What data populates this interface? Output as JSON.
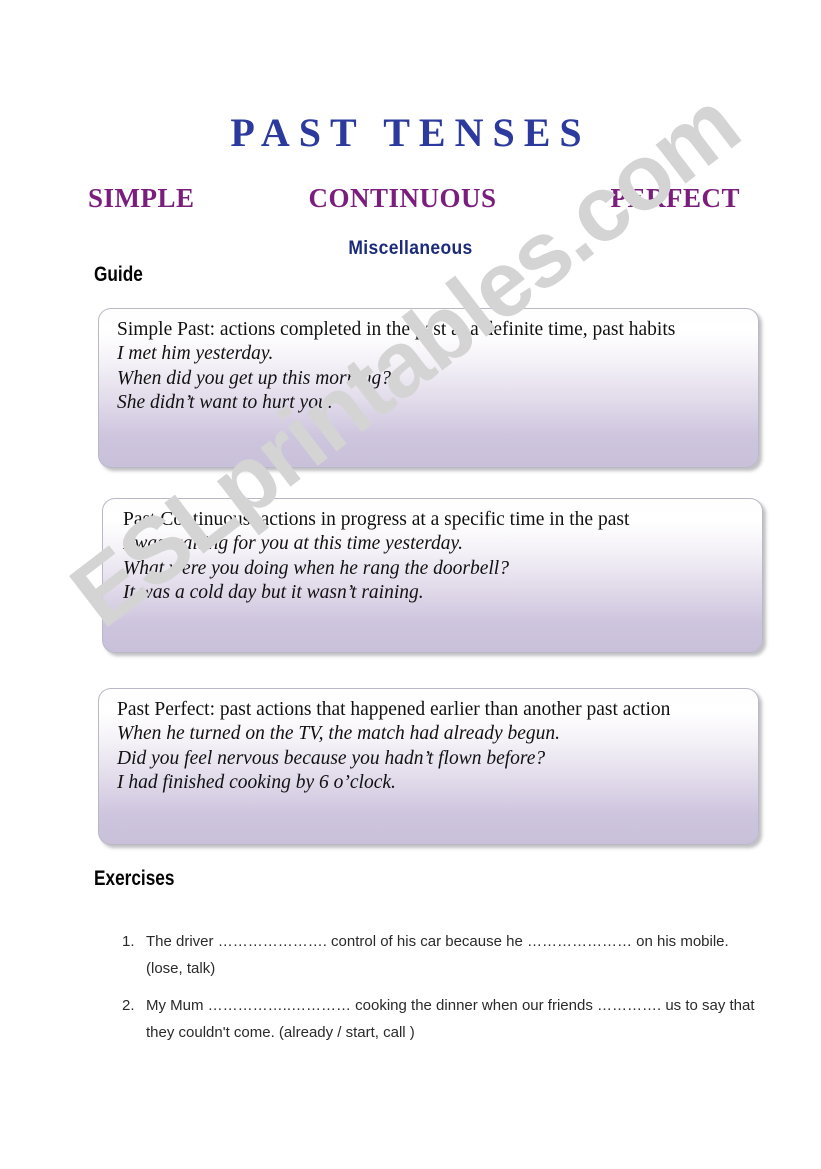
{
  "page": {
    "title": "PAST TENSES",
    "subtitles": [
      "SIMPLE",
      "CONTINUOUS",
      "PERFECT"
    ],
    "misc_label": "Miscellaneous",
    "guide_heading": "Guide",
    "exercises_heading": "Exercises",
    "watermark": "ESLprintables.com"
  },
  "colors": {
    "title_blue": "#2b3a9c",
    "subtitle_purple": "#7b1d7d",
    "misc_navy": "#1c2a7a",
    "box_gradient_top": "#ffffff",
    "box_gradient_bottom": "#c9c0d9",
    "box_border": "#b9b9c6",
    "watermark_gray": "#d4d4d4",
    "body_text": "#111111"
  },
  "guide": {
    "boxes": [
      {
        "id": "simple",
        "definition": "Simple Past: actions completed in the past at a definite time, past habits",
        "examples": [
          "I met him yesterday.",
          "When did you get up this morning?",
          "She didn’t want to hurt you."
        ]
      },
      {
        "id": "continuous",
        "definition": "Past Continuous: actions in progress at a specific time in the past",
        "examples": [
          "I was waiting for you at this time yesterday.",
          "What were you doing when he rang the doorbell?",
          "It was a cold day but it wasn’t raining."
        ]
      },
      {
        "id": "perfect",
        "definition": "Past Perfect: past actions that happened earlier than another past action",
        "examples": [
          "When he turned on the TV, the match had already begun.",
          "Did you feel nervous because you hadn’t flown before?",
          "I had finished cooking by 6 o’clock."
        ]
      }
    ]
  },
  "exercises": {
    "items": [
      {
        "number": "1.",
        "text": "The driver …………………. control of his car because he …………………  on his mobile. (lose, talk)"
      },
      {
        "number": "2.",
        "text": "My Mum ……………..………… cooking the dinner when our friends …………. us to say that they couldn't come.  (already / start, call )"
      }
    ]
  }
}
